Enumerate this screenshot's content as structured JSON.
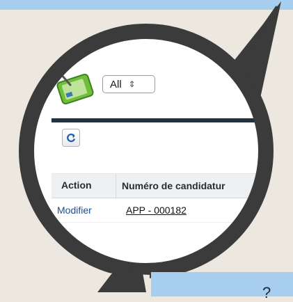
{
  "view": {
    "select_value": "All",
    "select_arrows": "⇕"
  },
  "toolbar": {
    "refresh_icon": "refresh-icon"
  },
  "table": {
    "columns": [
      "Action",
      "Numéro de candidatur"
    ],
    "rows": [
      {
        "action": "Modifier",
        "record": "APP - 000182"
      }
    ]
  },
  "footer": {
    "glyph": "?"
  },
  "colors": {
    "banner": "#a7cdef",
    "background": "#ece8df",
    "ring": "#3b3b3b",
    "link": "#1e4d8c",
    "strip": "#24323e"
  }
}
